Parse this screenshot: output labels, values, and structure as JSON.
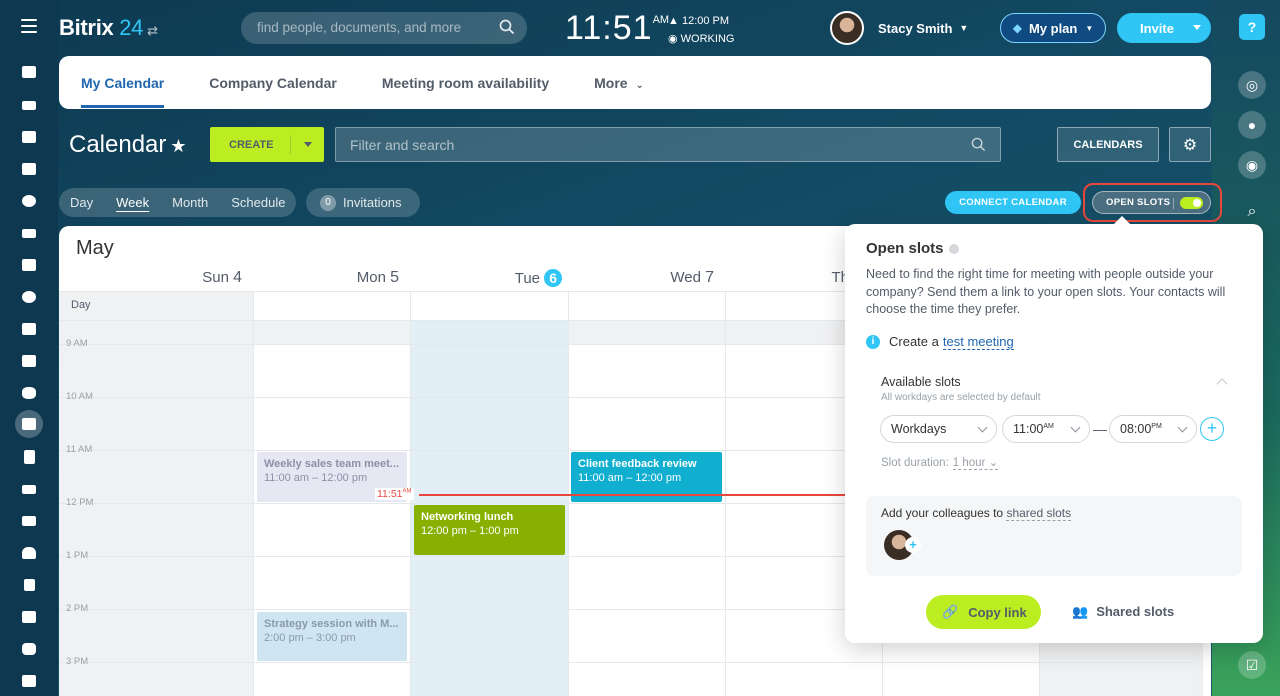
{
  "header": {
    "logo_main": "Bitrix",
    "logo_num": "24",
    "search_placeholder": "find people, documents, and more",
    "clock": "11:51",
    "clock_ampm": "AM",
    "alarm_time": "12:00 PM",
    "work_status": "WORKING",
    "user_name": "Stacy Smith",
    "myplan_label": "My plan",
    "invite_label": "Invite"
  },
  "tabs": [
    "My Calendar",
    "Company Calendar",
    "Meeting room availability",
    "More"
  ],
  "toolbar": {
    "title": "Calendar",
    "create_label": "CREATE",
    "filter_placeholder": "Filter and search",
    "calendars_label": "CALENDARS"
  },
  "views": [
    "Day",
    "Week",
    "Month",
    "Schedule"
  ],
  "invitations": {
    "count": "0",
    "label": "Invitations"
  },
  "connect_label": "CONNECT CALENDAR",
  "open_slots_label": "OPEN SLOTS",
  "calendar": {
    "month": "May",
    "days": [
      {
        "name": "Sun",
        "num": "4"
      },
      {
        "name": "Mon",
        "num": "5"
      },
      {
        "name": "Tue",
        "num": "6"
      },
      {
        "name": "Wed",
        "num": "7"
      },
      {
        "name": "Th",
        "num": ""
      }
    ],
    "day_label": "Day",
    "hours": [
      "9 AM",
      "10 AM",
      "11 AM",
      "12 PM",
      "1 PM",
      "2 PM",
      "3 PM"
    ],
    "now_label": "11:51",
    "now_ampm": "AM",
    "events": [
      {
        "title": "Weekly sales team meet...",
        "time": "11:00 am – 12:00 pm"
      },
      {
        "title": "Client feedback review",
        "time": "11:00 am – 12:00 pm"
      },
      {
        "title": "Networking lunch",
        "time": "12:00 pm – 1:00 pm"
      },
      {
        "title": "Strategy session with M...",
        "time": "2:00 pm – 3:00 pm"
      }
    ]
  },
  "popup": {
    "title": "Open slots",
    "description": "Need to find the right time for meeting with people outside your company? Send them a link to your open slots. Your contacts will choose the time they prefer.",
    "create_prefix": "Create a",
    "create_link": "test meeting",
    "available_title": "Available slots",
    "available_sub": "All workdays are selected by default",
    "days_select": "Workdays",
    "from_time": "11:00",
    "from_ampm": "AM",
    "to_time": "08:00",
    "to_ampm": "PM",
    "duration_label": "Slot duration:",
    "duration_value": "1 hour",
    "colleagues_prefix": "Add your colleagues to",
    "colleagues_link": "shared slots",
    "copy_label": "Copy link",
    "shared_label": "Shared slots"
  },
  "colors": {
    "accent": "#2fc6f6",
    "create_green": "#bbed21",
    "event_green": "#88b000",
    "event_blue": "#10afcf",
    "now_red": "#e7473d"
  }
}
